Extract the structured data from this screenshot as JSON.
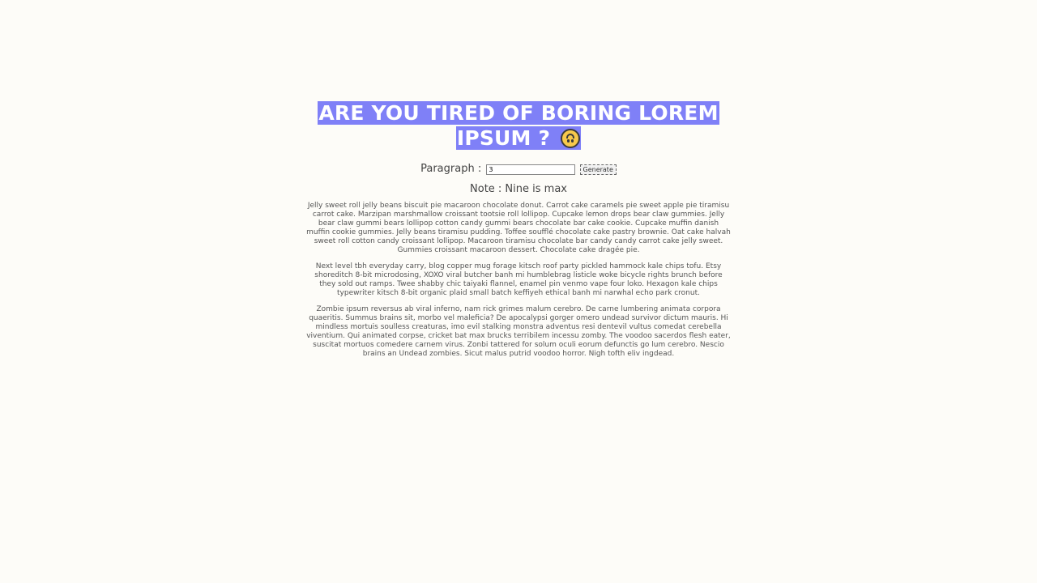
{
  "header": {
    "title": "ARE YOU TIRED OF BORING LOREM IPSUM ?",
    "emoji_icon": "upside-down-face-icon"
  },
  "form": {
    "paragraph_label": "Paragraph :",
    "paragraph_value": "3",
    "generate_label": "Generate"
  },
  "note": "Note : Nine is max",
  "paragraphs": [
    "Jelly sweet roll jelly beans biscuit pie macaroon chocolate donut. Carrot cake caramels pie sweet apple pie tiramisu carrot cake. Marzipan marshmallow croissant tootsie roll lollipop. Cupcake lemon drops bear claw gummies. Jelly bear claw gummi bears lollipop cotton candy gummi bears chocolate bar cake cookie. Cupcake muffin danish muffin cookie gummies. Jelly beans tiramisu pudding. Toffee soufflé chocolate cake pastry brownie. Oat cake halvah sweet roll cotton candy croissant lollipop. Macaroon tiramisu chocolate bar candy candy carrot cake jelly sweet. Gummies croissant macaroon dessert. Chocolate cake dragée pie.",
    "Next level tbh everyday carry, blog copper mug forage kitsch roof party pickled hammock kale chips tofu. Etsy shoreditch 8-bit microdosing, XOXO viral butcher banh mi humblebrag listicle woke bicycle rights brunch before they sold out ramps. Twee shabby chic taiyaki flannel, enamel pin venmo vape four loko. Hexagon kale chips typewriter kitsch 8-bit organic plaid small batch keffiyeh ethical banh mi narwhal echo park cronut.",
    "Zombie ipsum reversus ab viral inferno, nam rick grimes malum cerebro. De carne lumbering animata corpora quaeritis. Summus brains sit, morbo vel maleficia? De apocalypsi gorger omero undead survivor dictum mauris. Hi mindless mortuis soulless creaturas, imo evil stalking monstra adventus resi dentevil vultus comedat cerebella viventium. Qui animated corpse, cricket bat max brucks terribilem incessu zomby. The voodoo sacerdos flesh eater, suscitat mortuos comedere carnem virus. Zonbi tattered for solum oculi eorum defunctis go lum cerebro. Nescio brains an Undead zombies. Sicut malus putrid voodoo horror. Nigh tofth eliv ingdead."
  ],
  "colors": {
    "background": "#fdfcf8",
    "title_highlight": "#7f80f7",
    "title_text": "#ffffff"
  }
}
